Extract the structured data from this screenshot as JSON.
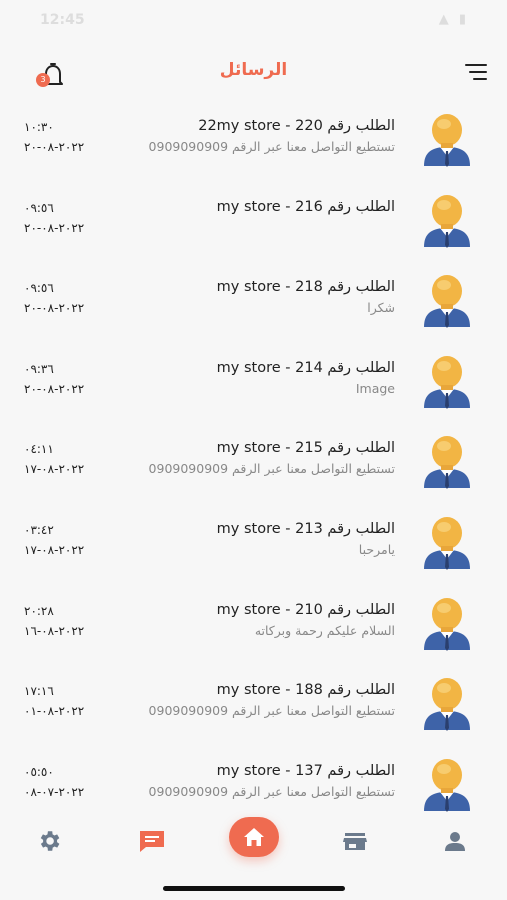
{
  "status_bar": {
    "time": "12:45",
    "icons": "▲ ▮"
  },
  "header": {
    "title": "الرسائل",
    "notification_count": "3"
  },
  "conversations": [
    {
      "title": "22my store - الطلب رقم 220",
      "preview": "تستطيع التواصل معنا عبر الرقم ",
      "phone": "0909090909",
      "time": "١٠:٣٠",
      "date": "٢٠٢٢-٠٨-٢٠"
    },
    {
      "title": "my store - الطلب رقم 216",
      "preview": "",
      "phone": "",
      "time": "٠٩:٥٦",
      "date": "٢٠٢٢-٠٨-٢٠"
    },
    {
      "title": "my store - الطلب رقم 218",
      "preview": "شكرا",
      "phone": "",
      "time": "٠٩:٥٦",
      "date": "٢٠٢٢-٠٨-٢٠"
    },
    {
      "title": "my store - الطلب رقم 214",
      "preview": "Image",
      "phone": "",
      "time": "٠٩:٣٦",
      "date": "٢٠٢٢-٠٨-٢٠"
    },
    {
      "title": "my store - الطلب رقم 215",
      "preview": "تستطيع التواصل معنا عبر الرقم ",
      "phone": "0909090909",
      "time": "٠٤:١١",
      "date": "٢٠٢٢-٠٨-١٧"
    },
    {
      "title": "my store - الطلب رقم 213",
      "preview": "يامرحبا",
      "phone": "",
      "time": "٠٣:٤٢",
      "date": "٢٠٢٢-٠٨-١٧"
    },
    {
      "title": "my store - الطلب رقم 210",
      "preview": "السلام عليكم رحمة وبركاته",
      "phone": "",
      "time": "٢٠:٢٨",
      "date": "٢٠٢٢-٠٨-١٦"
    },
    {
      "title": "my store - الطلب رقم 188",
      "preview": "تستطيع التواصل معنا عبر الرقم ",
      "phone": "0909090909",
      "time": "١٧:١٦",
      "date": "٢٠٢٢-٠٨-٠١"
    },
    {
      "title": "my store - الطلب رقم 137",
      "preview": "تستطيع التواصل معنا عبر الرقم ",
      "phone": "0909090909",
      "time": "٠٥:٥٠",
      "date": "٢٠٢٢-٠٧-٠٨"
    }
  ],
  "tabs": [
    {
      "name": "settings",
      "icon": "gear-icon",
      "active": false
    },
    {
      "name": "messages",
      "icon": "chat-icon",
      "active": true
    },
    {
      "name": "home",
      "icon": "home-icon",
      "active": false
    },
    {
      "name": "store",
      "icon": "store-icon",
      "active": false
    },
    {
      "name": "profile",
      "icon": "user-icon",
      "active": false
    }
  ],
  "colors": {
    "accent": "#ef6b50",
    "inactive_tab": "#6b7a8c",
    "background": "#f7f7f7"
  }
}
